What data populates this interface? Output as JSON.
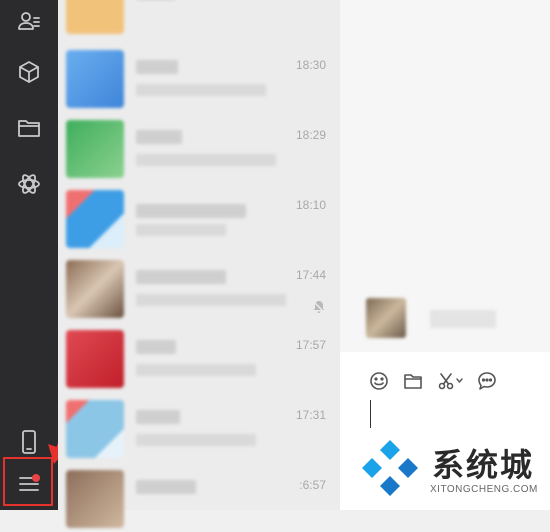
{
  "sidebar": {
    "icons": [
      "contacts-icon",
      "cube-icon",
      "folder-icon",
      "apps-icon",
      "phone-icon",
      "menu-icon"
    ],
    "menu_notification": true
  },
  "chat_list": {
    "items": [
      {
        "time": "",
        "avatar_color": "#f1c27a"
      },
      {
        "time": "18:30",
        "avatar_color": "#5aa0e6"
      },
      {
        "time": "18:29",
        "avatar_color": "#46b868"
      },
      {
        "time": "18:10",
        "avatar_color": "#3d9ee6"
      },
      {
        "time": "17:44",
        "avatar_color": "#8a6b54",
        "muted": true
      },
      {
        "time": "17:57",
        "avatar_color": "#d8323c"
      },
      {
        "time": "17:31",
        "avatar_color": "#8cc6e6"
      },
      {
        "time": ":6:57",
        "avatar_color": "#8c6e5a"
      }
    ]
  },
  "chat_panel": {
    "toolbar": [
      "emoji-icon",
      "folder-icon",
      "scissors-icon",
      "chat-bubble-icon"
    ]
  },
  "watermark": {
    "title": "系统城",
    "url": "XITONGCHENG.COM",
    "colors": [
      "#1aa3e8",
      "#1a78c8"
    ]
  }
}
